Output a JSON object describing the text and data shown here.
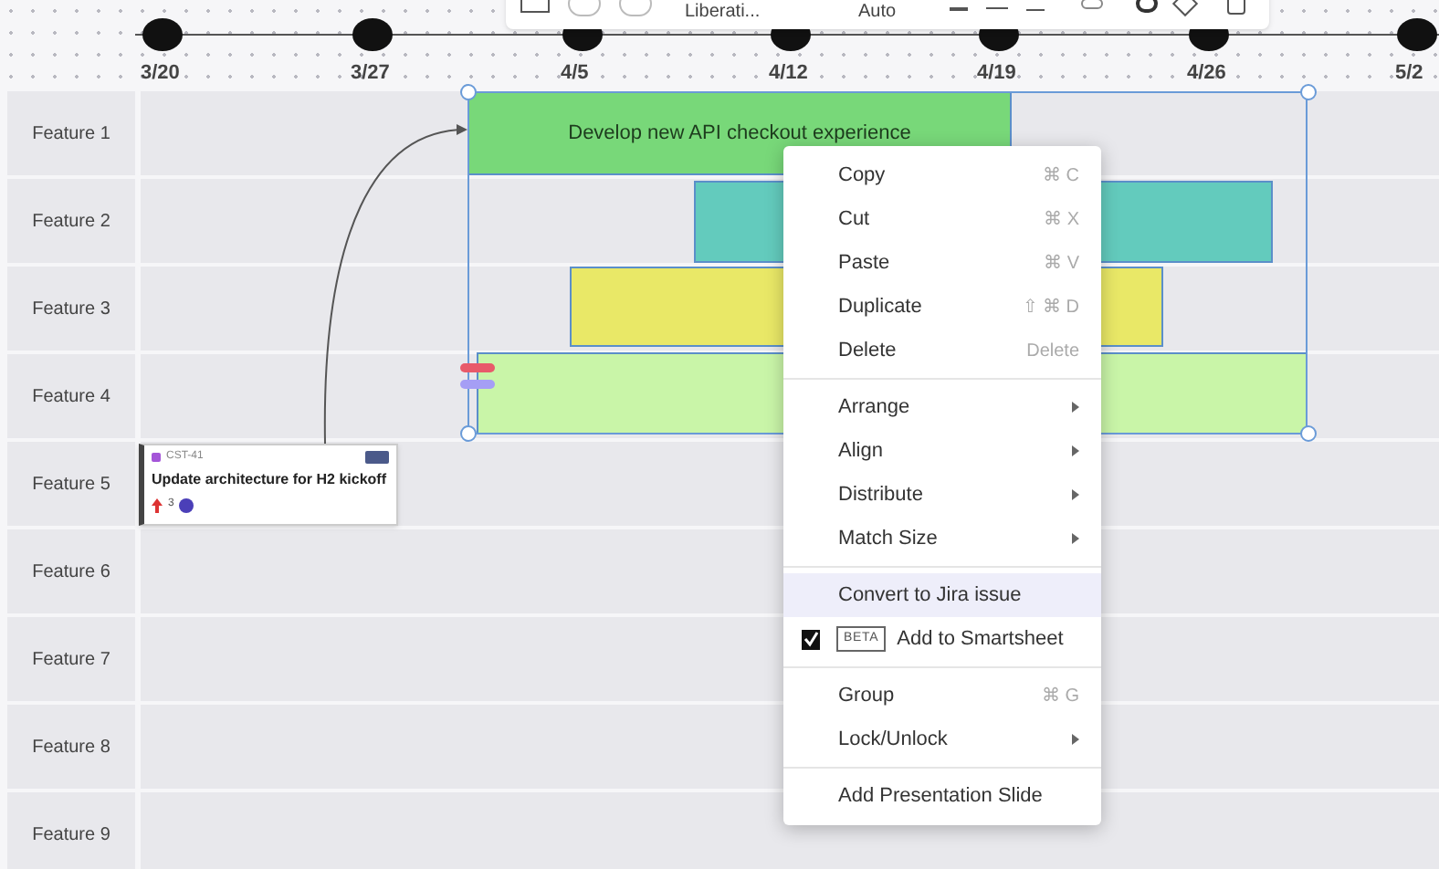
{
  "toolbar": {
    "font": "Liberati...",
    "size": "Auto"
  },
  "timeline": {
    "dates": [
      "3/20",
      "3/27",
      "4/5",
      "4/12",
      "4/19",
      "4/26",
      "5/2"
    ]
  },
  "rows": [
    {
      "label": "Feature 1"
    },
    {
      "label": "Feature 2"
    },
    {
      "label": "Feature 3"
    },
    {
      "label": "Feature 4"
    },
    {
      "label": "Feature 5"
    },
    {
      "label": "Feature 6"
    },
    {
      "label": "Feature 7"
    },
    {
      "label": "Feature 8"
    },
    {
      "label": "Feature 9"
    }
  ],
  "bars": [
    {
      "text": "Develop new API checkout experience",
      "color": "#78d879"
    },
    {
      "color": "#63cbbd"
    },
    {
      "color": "#e9e867"
    },
    {
      "color": "#c9f5a8"
    }
  ],
  "card": {
    "key": "CST-41",
    "title": "Update architecture for H2 kickoff",
    "count": "3"
  },
  "menu": {
    "sections": [
      [
        {
          "label": "Copy",
          "shortcut": "⌘ C",
          "submenu": false,
          "highlighted": false
        },
        {
          "label": "Cut",
          "shortcut": "⌘ X",
          "submenu": false,
          "highlighted": false
        },
        {
          "label": "Paste",
          "shortcut": "⌘ V",
          "submenu": false,
          "highlighted": false
        },
        {
          "label": "Duplicate",
          "shortcut": "⇧ ⌘ D",
          "submenu": false,
          "highlighted": false
        },
        {
          "label": "Delete",
          "shortcut": "Delete",
          "submenu": false,
          "highlighted": false
        }
      ],
      [
        {
          "label": "Arrange",
          "submenu": true,
          "highlighted": false
        },
        {
          "label": "Align",
          "submenu": true,
          "highlighted": false
        },
        {
          "label": "Distribute",
          "submenu": true,
          "highlighted": false
        },
        {
          "label": "Match Size",
          "submenu": true,
          "highlighted": false
        }
      ],
      [
        {
          "label": "Convert to Jira issue",
          "submenu": false,
          "highlighted": true
        },
        {
          "label": "Add to Smartsheet",
          "badge": "BETA",
          "submenu": false,
          "highlighted": false
        }
      ],
      [
        {
          "label": "Group",
          "shortcut": "⌘ G",
          "submenu": false,
          "highlighted": false
        },
        {
          "label": "Lock/Unlock",
          "submenu": true,
          "highlighted": false
        }
      ],
      [
        {
          "label": "Add Presentation Slide",
          "submenu": false,
          "highlighted": false
        }
      ]
    ]
  }
}
